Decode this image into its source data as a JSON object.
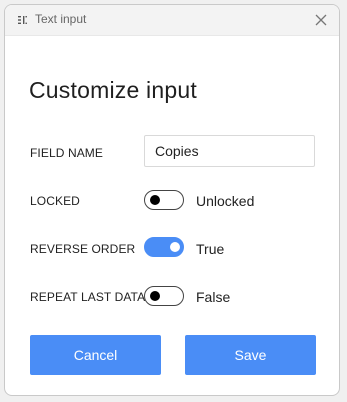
{
  "window": {
    "title": "Text input",
    "title_icon": "text-input-icon",
    "close_icon": "close-icon"
  },
  "dialog": {
    "heading": "Customize input"
  },
  "fields": {
    "field_name": {
      "label": "FIELD NAME",
      "value": "Copies"
    },
    "locked": {
      "label": "LOCKED",
      "on": false,
      "status": "Unlocked"
    },
    "reverse_order": {
      "label": "REVERSE ORDER",
      "on": true,
      "status": "True"
    },
    "repeat_last_data": {
      "label": "REPEAT LAST DATA",
      "on": false,
      "status": "False"
    }
  },
  "buttons": {
    "cancel_label": "Cancel",
    "save_label": "Save"
  },
  "colors": {
    "accent": "#4a8df6",
    "titlebar": "#f3f3f3"
  }
}
